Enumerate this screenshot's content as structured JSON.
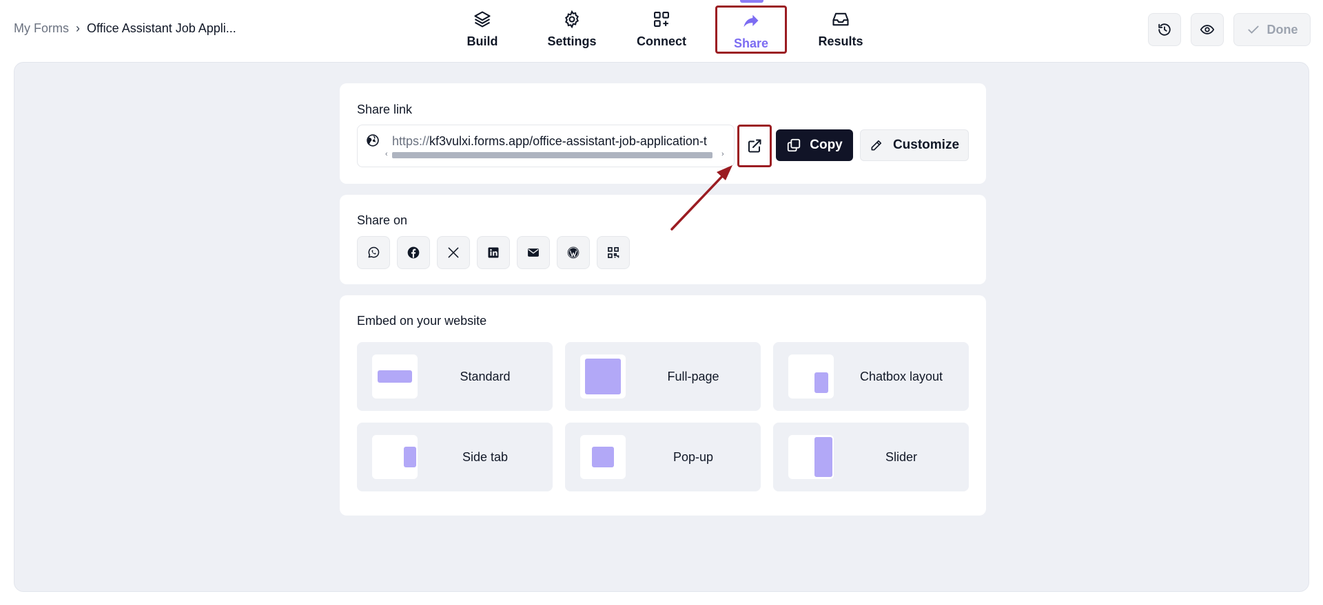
{
  "breadcrumb": {
    "root": "My Forms",
    "separator": "›",
    "current": "Office Assistant Job Appli..."
  },
  "tabs": [
    {
      "label": "Build",
      "icon": "layers-icon"
    },
    {
      "label": "Settings",
      "icon": "gear-icon"
    },
    {
      "label": "Connect",
      "icon": "apps-plus-icon"
    },
    {
      "label": "Share",
      "icon": "share-arrow-icon",
      "active": true
    },
    {
      "label": "Results",
      "icon": "inbox-icon"
    }
  ],
  "actions": {
    "history_icon": "history-icon",
    "preview_icon": "eye-icon",
    "done_label": "Done"
  },
  "share_link": {
    "title": "Share link",
    "protocol": "https://",
    "host_path": "kf3vulxi.forms.app/office-assistant-job-application-t",
    "copy_label": "Copy",
    "customize_label": "Customize"
  },
  "share_on": {
    "title": "Share on",
    "networks": [
      "whatsapp-icon",
      "facebook-icon",
      "x-icon",
      "linkedin-icon",
      "email-icon",
      "wordpress-icon",
      "qr-code-icon"
    ]
  },
  "embed": {
    "title": "Embed on your website",
    "options": [
      {
        "label": "Standard"
      },
      {
        "label": "Full-page"
      },
      {
        "label": "Chatbox layout"
      },
      {
        "label": "Side tab"
      },
      {
        "label": "Pop-up"
      },
      {
        "label": "Slider"
      }
    ]
  },
  "colors": {
    "accent": "#7c6cf2",
    "annotation": "#9b1c22",
    "primary_button": "#111427",
    "thumb_fill": "#b2a8f7",
    "canvas": "#eef0f5"
  }
}
